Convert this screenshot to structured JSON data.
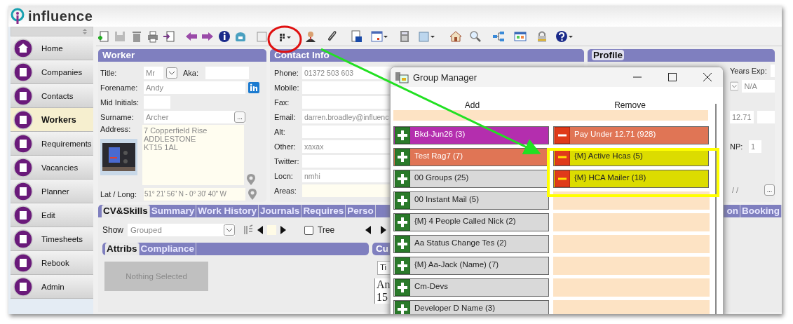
{
  "app": {
    "logo": "influence"
  },
  "sidebar": {
    "items": [
      {
        "label": "Home",
        "selected": false
      },
      {
        "label": "Companies",
        "selected": false
      },
      {
        "label": "Contacts",
        "selected": false
      },
      {
        "label": "Workers",
        "selected": true
      },
      {
        "label": "Requirements",
        "selected": false
      },
      {
        "label": "Vacancies",
        "selected": false
      },
      {
        "label": "Planner",
        "selected": false
      },
      {
        "label": "Edit",
        "selected": false
      },
      {
        "label": "Timesheets",
        "selected": false
      },
      {
        "label": "Rebook",
        "selected": false
      },
      {
        "label": "Admin",
        "selected": false
      }
    ]
  },
  "worker": {
    "title": "Worker",
    "title_label": "Title:",
    "title_value": "Mr",
    "aka_label": "Aka:",
    "forename_label": "Forename:",
    "forename_value": "Andy",
    "mid_initials_label": "Mid Initials:",
    "surname_label": "Surname:",
    "surname_value": "Archer",
    "surname_button": "...",
    "address_label": "Address:",
    "address_lines": [
      "7 Copperfield Rise",
      "ADDLESTONE",
      "KT15 1AL"
    ],
    "latlong_label": "Lat / Long:",
    "latlong_value": "51° 21' 56\" N - 0° 30' 40\" W"
  },
  "contact_info": {
    "title": "Contact Info",
    "fields": [
      {
        "label": "Phone:",
        "value": "01372 503 603",
        "kind": "text"
      },
      {
        "label": "Mobile:",
        "kind": "text"
      },
      {
        "label": "Fax:",
        "kind": "text"
      },
      {
        "label": "Email:",
        "value": "darren.broadley@influenc",
        "kind": "text"
      },
      {
        "label": "Alt:",
        "kind": "text"
      },
      {
        "label": "Other:",
        "value": "xaxax",
        "kind": "text"
      },
      {
        "label": "Twitter:",
        "kind": "text"
      },
      {
        "label": "Locn:",
        "value": "nmhi",
        "kind": "text"
      },
      {
        "label": "Areas:",
        "kind": "notes"
      }
    ]
  },
  "profile": {
    "title": "Profile",
    "years_exp_label": "Years Exp:",
    "grade_value": "N/A",
    "rate_value": "12.71",
    "np_label": "NP:",
    "np_value": "1",
    "date_value": "/  /",
    "date_button": "..."
  },
  "tabs_left": [
    {
      "label": "CV&Skills",
      "selected": true
    },
    {
      "label": "Summary",
      "selected": false
    },
    {
      "label": "Work History",
      "selected": false
    },
    {
      "label": "Journals",
      "selected": false
    },
    {
      "label": "Requires",
      "selected": false
    },
    {
      "label": "Perso",
      "selected": false
    }
  ],
  "tabs_right": [
    {
      "label": "on",
      "selected": false
    },
    {
      "label": "Booking",
      "selected": false
    }
  ],
  "cv_toolbar": {
    "show_label": "Show",
    "show_value": "Grouped",
    "tree_label": "Tree",
    "tree_checked": false
  },
  "subtabs": [
    {
      "label": "Attribs",
      "selected": true
    },
    {
      "label": "Compliance",
      "selected": false
    }
  ],
  "attribs_empty": "Nothing Selected",
  "cu_panel": {
    "title": "Cu",
    "field_value": "Ti",
    "text_lines": [
      "An",
      "15"
    ]
  },
  "group_manager": {
    "title": "Group Manager",
    "add_header": "Add",
    "remove_header": "Remove",
    "add_items": [
      {
        "label": "Bkd-Jun26 (3)",
        "color": "#b42eae"
      },
      {
        "label": "Test Rag7 (7)",
        "color": "#e07555"
      },
      {
        "label": "00 Groups (25)",
        "color": "#d9d9d9"
      },
      {
        "label": "00 Instant Mail (5)",
        "color": "#d9d9d9"
      },
      {
        "label": "{M} 4 People Called Nick (2)",
        "color": "#d9d9d9"
      },
      {
        "label": "Aa Status Change Tes (2)",
        "color": "#d9d9d9"
      },
      {
        "label": "{M} Aa-Jack (Name) (7)",
        "color": "#d9d9d9"
      },
      {
        "label": "Cm-Devs",
        "color": "#d9d9d9"
      },
      {
        "label": "Developer D Name (3)",
        "color": "#d9d9d9"
      }
    ],
    "remove_items": [
      {
        "label": "Pay Under 12.71 (928)",
        "color": "#e07555"
      },
      {
        "label": "{M} Active Hcas (5)",
        "color": "#dcdc00"
      },
      {
        "label": "{M} HCA Mailer (18)",
        "color": "#dcdc00"
      }
    ]
  }
}
